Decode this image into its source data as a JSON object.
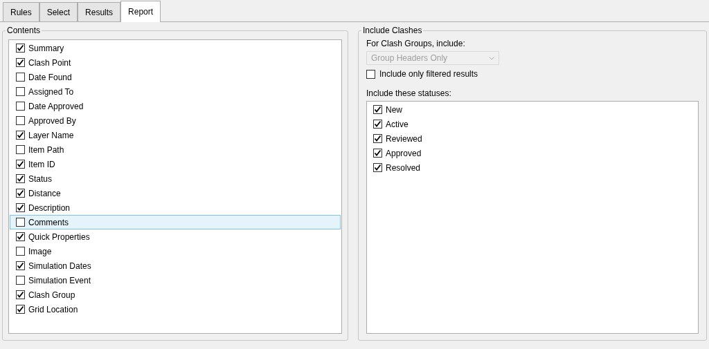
{
  "tabs": [
    {
      "label": "Rules",
      "selected": false
    },
    {
      "label": "Select",
      "selected": false
    },
    {
      "label": "Results",
      "selected": false
    },
    {
      "label": "Report",
      "selected": true
    }
  ],
  "contents": {
    "title": "Contents",
    "items": [
      {
        "label": "Summary",
        "checked": true,
        "selected": false
      },
      {
        "label": "Clash Point",
        "checked": true,
        "selected": false
      },
      {
        "label": "Date Found",
        "checked": false,
        "selected": false
      },
      {
        "label": "Assigned To",
        "checked": false,
        "selected": false
      },
      {
        "label": "Date Approved",
        "checked": false,
        "selected": false
      },
      {
        "label": "Approved By",
        "checked": false,
        "selected": false
      },
      {
        "label": "Layer Name",
        "checked": true,
        "selected": false
      },
      {
        "label": "Item Path",
        "checked": false,
        "selected": false
      },
      {
        "label": "Item ID",
        "checked": true,
        "selected": false
      },
      {
        "label": "Status",
        "checked": true,
        "selected": false
      },
      {
        "label": "Distance",
        "checked": true,
        "selected": false
      },
      {
        "label": "Description",
        "checked": true,
        "selected": false
      },
      {
        "label": "Comments",
        "checked": false,
        "selected": true
      },
      {
        "label": "Quick Properties",
        "checked": true,
        "selected": false
      },
      {
        "label": "Image",
        "checked": false,
        "selected": false
      },
      {
        "label": "Simulation Dates",
        "checked": true,
        "selected": false
      },
      {
        "label": "Simulation Event",
        "checked": false,
        "selected": false
      },
      {
        "label": "Clash Group",
        "checked": true,
        "selected": false
      },
      {
        "label": "Grid Location",
        "checked": true,
        "selected": false
      }
    ]
  },
  "include_clashes": {
    "title": "Include Clashes",
    "groups_label": "For Clash Groups, include:",
    "groups_dropdown": {
      "value": "Group Headers Only",
      "disabled": true
    },
    "filtered": {
      "label": "Include only filtered results",
      "checked": false
    },
    "statuses_label": "Include these statuses:",
    "statuses": [
      {
        "label": "New",
        "checked": true
      },
      {
        "label": "Active",
        "checked": true
      },
      {
        "label": "Reviewed",
        "checked": true
      },
      {
        "label": "Approved",
        "checked": true
      },
      {
        "label": "Resolved",
        "checked": true
      }
    ]
  }
}
